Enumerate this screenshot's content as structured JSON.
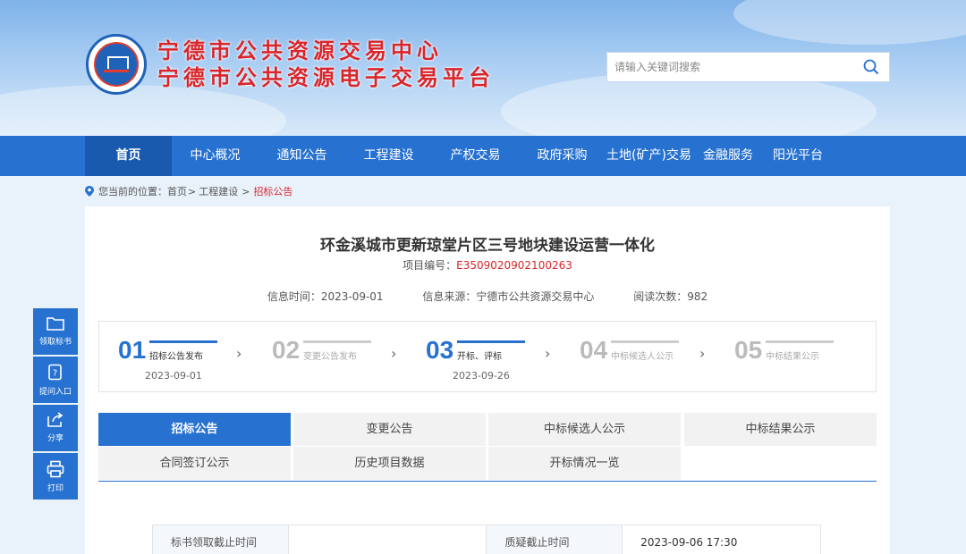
{
  "site": {
    "title_line1": "宁德市公共资源交易中心",
    "title_line2": "宁德市公共资源电子交易平台"
  },
  "search": {
    "placeholder": "请输入关键词搜索"
  },
  "nav": {
    "items": [
      {
        "label": "首页"
      },
      {
        "label": "中心概况"
      },
      {
        "label": "通知公告"
      },
      {
        "label": "工程建设"
      },
      {
        "label": "产权交易"
      },
      {
        "label": "政府采购"
      },
      {
        "label": "土地(矿产)交易"
      },
      {
        "label": "金融服务"
      },
      {
        "label": "阳光平台"
      }
    ],
    "active_index": 0
  },
  "breadcrumb": {
    "prefix": "您当前的位置：",
    "home": "首页",
    "sep1": ">",
    "section": "工程建设",
    "sep2": ">",
    "current": "招标公告"
  },
  "document": {
    "title": "环金溪城市更新琼堂片区三号地块建设运营一体化",
    "project_no_label": "项目编号：",
    "project_no": "E3509020902100263",
    "info_time": "信息时间：2023-09-01",
    "info_source": "信息来源：宁德市公共资源交易中心",
    "read_count": "阅读次数：982"
  },
  "steps": [
    {
      "num": "01",
      "label": "招标公告发布",
      "date": "2023-09-01",
      "done": true
    },
    {
      "num": "02",
      "label": "变更公告发布",
      "date": "",
      "done": false
    },
    {
      "num": "03",
      "label": "开标、评标",
      "date": "2023-09-26",
      "done": true
    },
    {
      "num": "04",
      "label": "中标候选人公示",
      "date": "",
      "done": false
    },
    {
      "num": "05",
      "label": "中标结果公示",
      "date": "",
      "done": false
    }
  ],
  "tabs": [
    {
      "label": "招标公告"
    },
    {
      "label": "变更公告"
    },
    {
      "label": "中标候选人公示"
    },
    {
      "label": "中标结果公示"
    },
    {
      "label": "合同签订公示"
    },
    {
      "label": "历史项目数据"
    },
    {
      "label": "开标情况一览"
    }
  ],
  "info_table": {
    "row1": {
      "k1": "标书领取截止时间",
      "v1": "",
      "k2": "质疑截止时间",
      "v2": "2023-09-06 17:30"
    }
  },
  "side_tools": [
    {
      "label": "领取标书",
      "icon": "folder-icon"
    },
    {
      "label": "提问入口",
      "icon": "question-icon"
    },
    {
      "label": "分享",
      "icon": "share-icon"
    },
    {
      "label": "打印",
      "icon": "print-icon"
    }
  ],
  "colors": {
    "primary": "#2772d0",
    "primary_dark": "#1959ae",
    "accent_red": "#d8262b"
  }
}
